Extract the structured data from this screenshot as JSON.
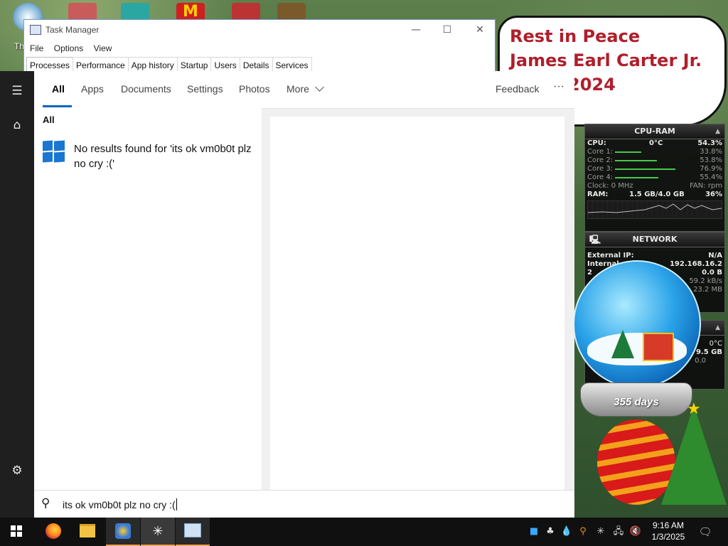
{
  "desktop": {
    "icon_label": "Th"
  },
  "rip_note": {
    "line1": "Rest in Peace",
    "line2": "James Earl Carter Jr.",
    "line3": "2024"
  },
  "cpu_gadget": {
    "title": "CPU-RAM",
    "cpu_label": "CPU:",
    "cpu_temp": "0°C",
    "cpu_value": "54.3%",
    "cores": [
      {
        "label": "Core 1:",
        "value": "33.8%",
        "level": 0.338
      },
      {
        "label": "Core 2:",
        "value": "53.8%",
        "level": 0.538
      },
      {
        "label": "Core 3:",
        "value": "76.9%",
        "level": 0.769
      },
      {
        "label": "Core 4:",
        "value": "55.4%",
        "level": 0.554
      }
    ],
    "clock_label": "Clock: 0 MHz",
    "fan_label": "FAN: rpm",
    "ram_label": "RAM:",
    "ram_usage": "1.5 GB/4.0 GB",
    "ram_value": "36%"
  },
  "network_gadget": {
    "title": "NETWORK",
    "external_label": "External IP:",
    "external_value": "N/A",
    "internal_label": "Internal",
    "internal_value": "192.168.16.2",
    "row3_label": "2",
    "row3_value": "0.0 B",
    "row4_value": "59.2 kB/s",
    "row5_value": "23.2 MB"
  },
  "third_gadget": {
    "temp": "0°C",
    "size": "9.5 GB",
    "val": "0.0"
  },
  "globe": {
    "days": "355 days"
  },
  "task_manager": {
    "title": "Task Manager",
    "menu": [
      "File",
      "Options",
      "View"
    ],
    "tabs": [
      "Processes",
      "Performance",
      "App history",
      "Startup",
      "Users",
      "Details",
      "Services"
    ],
    "active_tab": "Processes",
    "minimize": "—",
    "maximize": "☐",
    "close": "✕"
  },
  "search": {
    "tabs": [
      "All",
      "Apps",
      "Documents",
      "Settings",
      "Photos",
      "More"
    ],
    "active_tab": "All",
    "feedback": "Feedback",
    "more_options": "···",
    "section_label": "All",
    "no_results": "No results found for 'its ok vm0b0t plz no cry :('",
    "query": "its ok vm0b0t plz no cry :("
  },
  "taskbar": {
    "time": "9:16 AM",
    "date": "1/3/2025"
  },
  "colors": {
    "accent": "#0067c0",
    "rip_text": "#b01e2a",
    "taskbar": "#101010"
  }
}
